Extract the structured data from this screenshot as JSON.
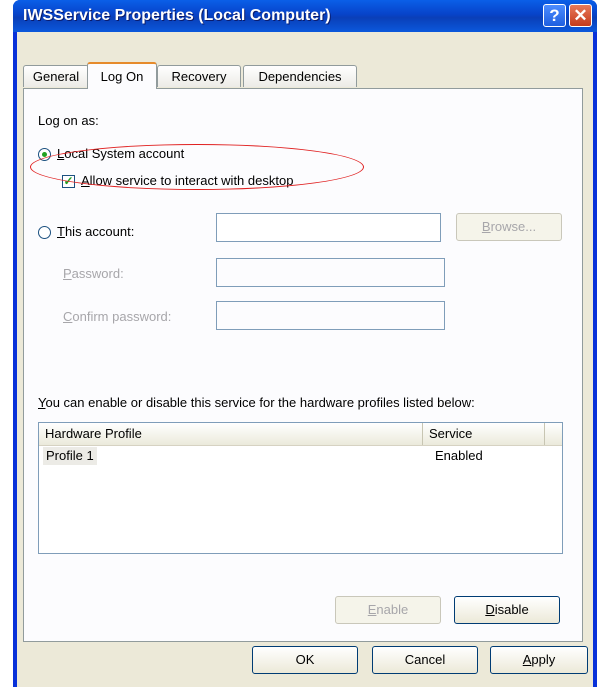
{
  "window": {
    "title": "IWSService Properties (Local Computer)",
    "help_glyph": "?",
    "close_glyph": "✕"
  },
  "tabs": [
    {
      "label": "General",
      "active": false
    },
    {
      "label": "Log On",
      "active": true
    },
    {
      "label": "Recovery",
      "active": false
    },
    {
      "label": "Dependencies",
      "active": false
    }
  ],
  "logon": {
    "heading": "Log on as:",
    "local_system": {
      "first": "L",
      "rest": "ocal System account",
      "selected": true
    },
    "allow_interact": {
      "first": "A",
      "rest": "llow service to interact with desktop",
      "checked": true
    },
    "this_account": {
      "first": "T",
      "rest": "his account:",
      "selected": false
    },
    "browse": {
      "first": "B",
      "rest": "rowse..."
    },
    "password": {
      "first": "P",
      "rest": "assword:"
    },
    "confirm": {
      "first": "C",
      "rest": "onfirm password:"
    }
  },
  "profiles": {
    "caption_first": "Y",
    "caption_rest": "ou can enable or disable this service for the hardware profiles listed below:",
    "columns": [
      "Hardware Profile",
      "Service"
    ],
    "rows": [
      {
        "profile": "Profile 1",
        "service": "Enabled"
      }
    ],
    "enable": {
      "first": "E",
      "rest": "nable"
    },
    "disable": {
      "first": "D",
      "rest": "isable"
    }
  },
  "footer": {
    "ok": "OK",
    "cancel": "Cancel",
    "apply": {
      "first": "A",
      "rest": "pply"
    }
  },
  "colors": {
    "title_bar": "#0a4fd6",
    "annotation": "#e02020",
    "accent_tab": "#e68b2c"
  }
}
